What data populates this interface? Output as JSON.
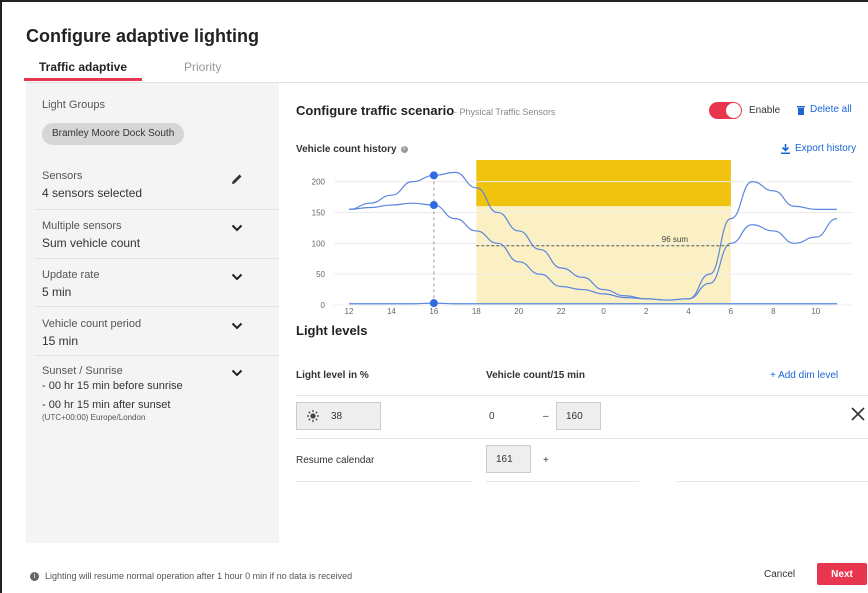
{
  "dialog": {
    "title": "Configure adaptive lighting"
  },
  "tabs": [
    {
      "label": "Traffic adaptive",
      "active": true
    },
    {
      "label": "Priority",
      "active": false
    }
  ],
  "sidebar": {
    "light_groups": {
      "label": "Light Groups",
      "chip": "Bramley Moore Dock South"
    },
    "sensors": {
      "label": "Sensors",
      "value": "4 sensors selected",
      "icon": "pencil-icon"
    },
    "multiple_sensors": {
      "label": "Multiple sensors",
      "value": "Sum vehicle count",
      "icon": "chevron-down-icon"
    },
    "update_rate": {
      "label": "Update rate",
      "value": "5 min",
      "icon": "chevron-down-icon"
    },
    "vehicle_count_period": {
      "label": "Vehicle count period",
      "value": "15 min",
      "icon": "chevron-down-icon"
    },
    "sunset_sunrise": {
      "label": "Sunset / Sunrise",
      "line1": "- 00 hr 15 min before sunrise",
      "line2": "- 00 hr 15 min after sunset",
      "timezone": "(UTC+00:00) Europe/London",
      "icon": "chevron-down-icon"
    }
  },
  "scenario": {
    "title": "Configure traffic scenario",
    "subtitle": "- Physical Traffic Sensors",
    "enable_label": "Enable",
    "enabled": true,
    "delete_all_label": "Delete all",
    "history_title": "Vehicle count history",
    "export_label": "Export history"
  },
  "chart_data": {
    "type": "line",
    "x_ticks": [
      "12",
      "14",
      "16",
      "18",
      "20",
      "22",
      "0",
      "2",
      "4",
      "6",
      "8",
      "10"
    ],
    "y_ticks": [
      "0",
      "50",
      "100",
      "150",
      "200"
    ],
    "ylim": [
      0,
      235
    ],
    "x": [
      12,
      13,
      14,
      15,
      16,
      17,
      18,
      19,
      20,
      21,
      22,
      23,
      24,
      25,
      26,
      27,
      28,
      29,
      30,
      31,
      32,
      33,
      34,
      35
    ],
    "series": [
      {
        "values": [
          155,
          165,
          178,
          200,
          210,
          215,
          190,
          150,
          120,
          90,
          60,
          45,
          25,
          15,
          10,
          8,
          10,
          50,
          140,
          200,
          185,
          160,
          155,
          155
        ]
      },
      {
        "values": [
          155,
          158,
          162,
          165,
          162,
          140,
          120,
          100,
          70,
          50,
          30,
          25,
          18,
          12,
          10,
          8,
          10,
          35,
          100,
          130,
          120,
          100,
          110,
          140
        ]
      },
      {
        "values": [
          2,
          2,
          2,
          2,
          3,
          2,
          2,
          2,
          2,
          2,
          2,
          2,
          2,
          2,
          2,
          2,
          2,
          2,
          2,
          2,
          2,
          2,
          2,
          2
        ]
      }
    ],
    "highlight": {
      "x_start": 18,
      "x_end": 30,
      "upper_min": 160,
      "upper_max": 235,
      "lower_min": 0,
      "lower_max": 160
    },
    "reference_line": {
      "y": 96,
      "label": "96 sum"
    },
    "cursor_x": 16,
    "colors": {
      "line": "#5b87df",
      "highlight_upper": "#f0c30f",
      "highlight_lower": "#fbf0c3",
      "cursor_point": "#2f6ae0"
    }
  },
  "light_levels": {
    "title": "Light levels",
    "col_light": "Light level in %",
    "col_vehicle": "Vehicle count/15 min",
    "add_dim_label": "+ Add dim level",
    "rows": [
      {
        "level": "38",
        "from": "0",
        "dash": "–",
        "to": "160",
        "icon": "sun-dim-icon"
      }
    ],
    "resume": {
      "label": "Resume calendar",
      "value": "161",
      "suffix": "+"
    }
  },
  "footer": {
    "note": "Lighting will resume normal operation after 1 hour 0 min if no data is received",
    "cancel_label": "Cancel",
    "next_label": "Next"
  }
}
